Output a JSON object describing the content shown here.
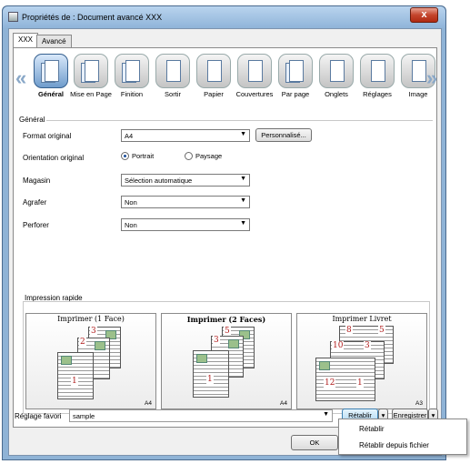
{
  "window": {
    "title": "Propriétés de : Document avancé XXX",
    "close_label": "x"
  },
  "tabs": [
    {
      "label": "XXX"
    },
    {
      "label": "Avancé"
    }
  ],
  "toolbar": {
    "items": [
      {
        "label": "Général",
        "icon": "general-icon"
      },
      {
        "label": "Mise en Page",
        "icon": "layout-icon"
      },
      {
        "label": "Finition",
        "icon": "finishing-icon"
      },
      {
        "label": "Sortir",
        "icon": "output-icon"
      },
      {
        "label": "Papier",
        "icon": "paper-icon"
      },
      {
        "label": "Couvertures",
        "icon": "cover-icon"
      },
      {
        "label": "Par page",
        "icon": "per-page-icon"
      },
      {
        "label": "Onglets",
        "icon": "tabs-icon"
      },
      {
        "label": "Réglages",
        "icon": "settings-icon"
      },
      {
        "label": "Image",
        "icon": "image-icon"
      }
    ],
    "left_arrow": "«",
    "right_arrow": "»"
  },
  "general": {
    "section": "Général",
    "format_label": "Format original",
    "format_value": "A4",
    "custom_button": "Personnalisé...",
    "orientation_label": "Orientation original",
    "portrait": "Portrait",
    "landscape": "Paysage",
    "tray_label": "Magasin",
    "tray_value": "Sélection automatique",
    "staple_label": "Agrafer",
    "staple_value": "Non",
    "punch_label": "Perforer",
    "punch_value": "Non"
  },
  "quick": {
    "title": "Impression rapide",
    "cards": [
      {
        "title": "Imprimer (1 Face)",
        "size": "A4"
      },
      {
        "title": "Imprimer (2 Faces)",
        "size": "A4"
      },
      {
        "title": "Imprimer Livret",
        "size": "A3"
      }
    ]
  },
  "footer": {
    "favorite_label": "Réglage favori",
    "favorite_value": "sample",
    "reset_button": "Rétablir",
    "save_button": "Enregistrer",
    "ok_button": "OK"
  },
  "reset_menu": [
    "Rétablir",
    "Rétablir depuis fichier"
  ]
}
